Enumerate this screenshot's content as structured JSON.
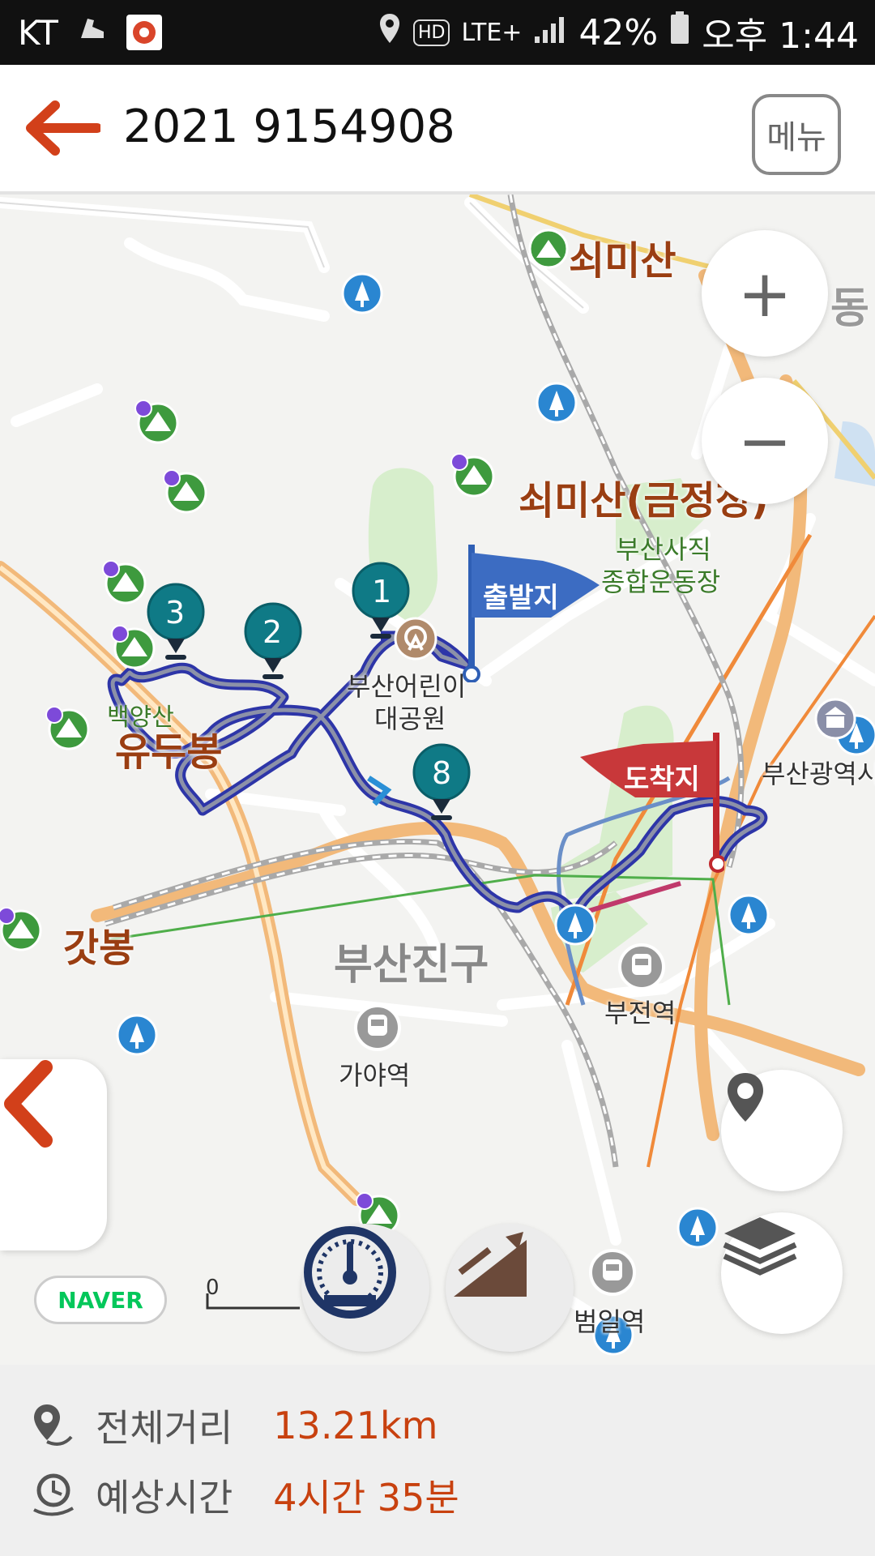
{
  "status_bar": {
    "carrier": "KT",
    "network": "LTE+",
    "battery": "42%",
    "time": "오후 1:44",
    "hd": "HD"
  },
  "header": {
    "title": "2021 9154908",
    "menu_label": "메뉴"
  },
  "map": {
    "labels": {
      "soemisan": "쇠미산",
      "dong": "동",
      "soemisan_geumjeong": "쇠미산(금정정)",
      "sajik_stadium_1": "부산사직",
      "sajik_stadium_2": "종합운동장",
      "childrens_park_1": "부산어린이",
      "childrens_park_2": "대공원",
      "yudubong": "유두봉",
      "baegyangsan": "백양산",
      "gatbong": "갓봉",
      "busanjingu": "부산진구",
      "gaya_station": "가야역",
      "bujeon_station": "부전역",
      "beomil_station": "범일역",
      "busan_city": "부산광역시"
    },
    "flags": {
      "start": "출발지",
      "end": "도착지"
    },
    "waypoints": [
      "1",
      "2",
      "3",
      "8"
    ],
    "route_color": "#3340b8",
    "zoom_in": "+",
    "zoom_out": "−",
    "provider": "NAVER",
    "scale_zero": "0"
  },
  "summary": {
    "distance_label": "전체거리",
    "distance_value": "13.21km",
    "time_label": "예상시간",
    "time_value": "4시간 35분"
  }
}
